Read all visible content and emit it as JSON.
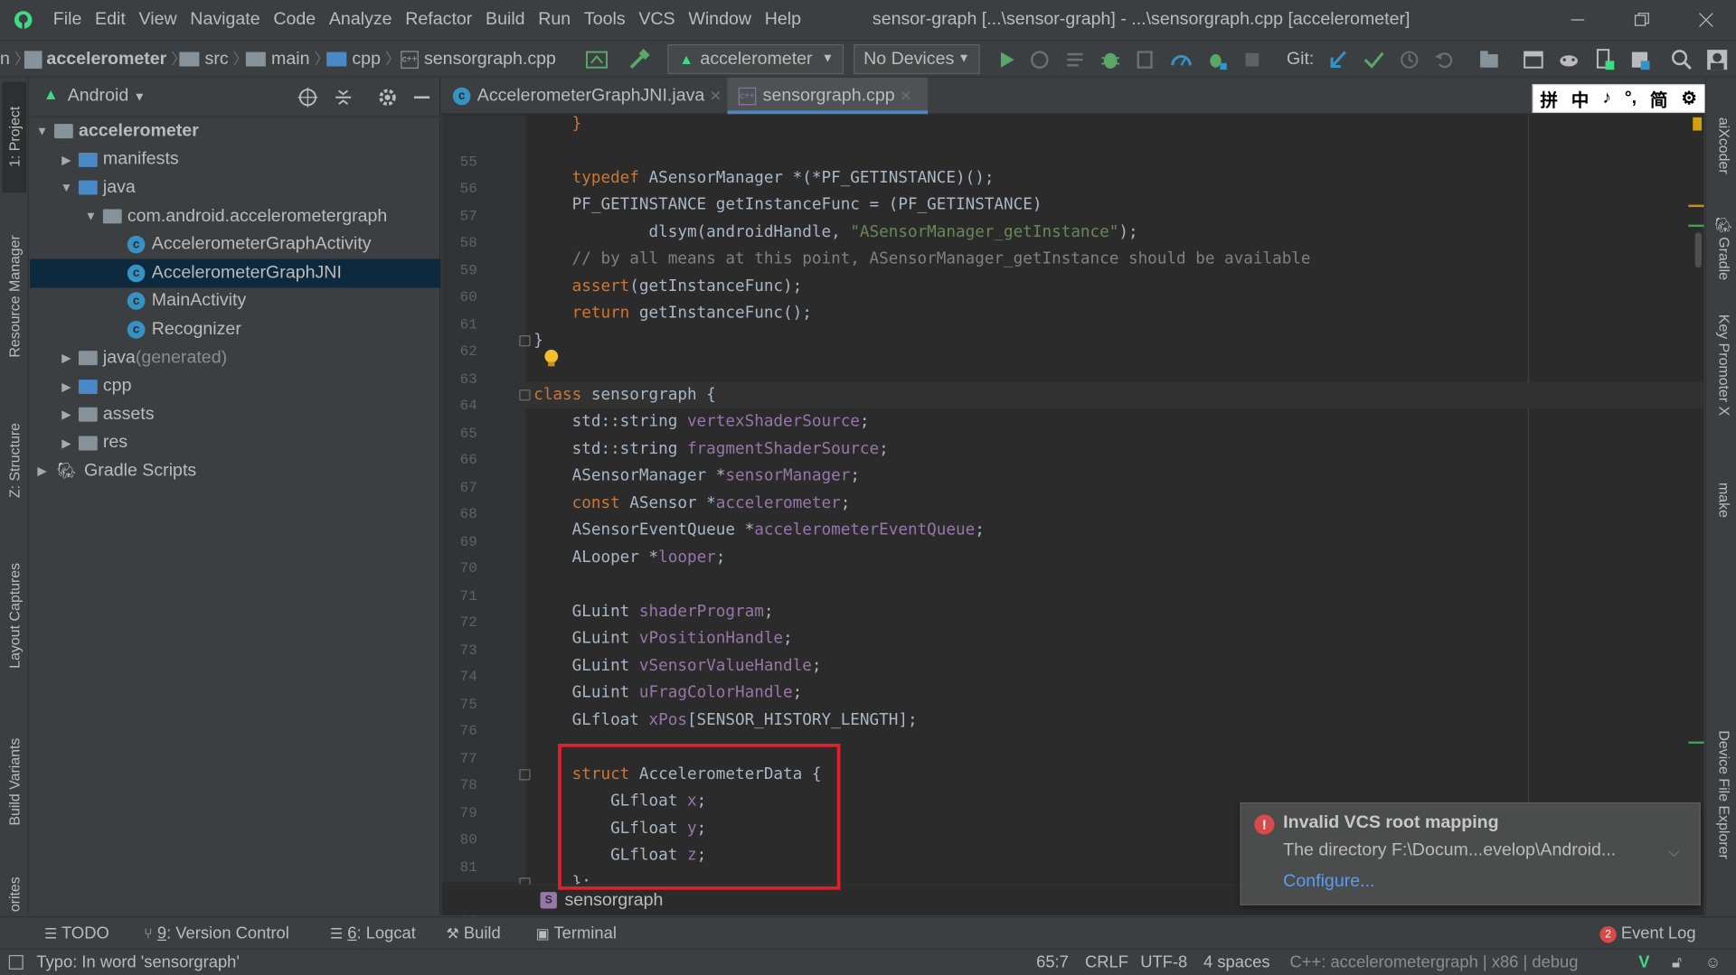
{
  "menu": [
    "File",
    "Edit",
    "View",
    "Navigate",
    "Code",
    "Analyze",
    "Refactor",
    "Build",
    "Run",
    "Tools",
    "VCS",
    "Window",
    "Help"
  ],
  "window_title": "sensor-graph [...\\sensor-graph] - ...\\sensorgraph.cpp [accelerometer]",
  "breadcrumbs": [
    "n",
    "accelerometer",
    "src",
    "main",
    "cpp",
    "sensorgraph.cpp"
  ],
  "run_config": "accelerometer",
  "device": "No Devices",
  "git_label": "Git:",
  "left_strip_tabs": [
    "1: Project",
    "Resource Manager",
    "Z: Structure",
    "Layout Captures",
    "Build Variants",
    "orites"
  ],
  "project_view": "Android",
  "tree": [
    {
      "label": "accelerometer",
      "indent": 0,
      "arrow": "▼",
      "icon": "module",
      "bold": true
    },
    {
      "label": "manifests",
      "indent": 1,
      "arrow": "▶",
      "icon": "folder-blue"
    },
    {
      "label": "java",
      "indent": 1,
      "arrow": "▼",
      "icon": "folder-blue"
    },
    {
      "label": "com.android.accelerometergraph",
      "indent": 2,
      "arrow": "▼",
      "icon": "package"
    },
    {
      "label": "AccelerometerGraphActivity",
      "indent": 3,
      "arrow": "",
      "icon": "class"
    },
    {
      "label": "AccelerometerGraphJNI",
      "indent": 3,
      "arrow": "",
      "icon": "class",
      "selected": true
    },
    {
      "label": "MainActivity",
      "indent": 3,
      "arrow": "",
      "icon": "class"
    },
    {
      "label": "Recognizer",
      "indent": 3,
      "arrow": "",
      "icon": "class"
    },
    {
      "label": "java",
      "suffix": " (generated)",
      "indent": 1,
      "arrow": "▶",
      "icon": "folder-gen"
    },
    {
      "label": "cpp",
      "indent": 1,
      "arrow": "▶",
      "icon": "folder-blue"
    },
    {
      "label": "assets",
      "indent": 1,
      "arrow": "▶",
      "icon": "folder-res"
    },
    {
      "label": "res",
      "indent": 1,
      "arrow": "▶",
      "icon": "folder-res"
    },
    {
      "label": "Gradle Scripts",
      "indent": 0,
      "arrow": "▶",
      "icon": "gradle"
    }
  ],
  "tabs": [
    {
      "label": "AccelerometerGraphJNI.java",
      "active": false
    },
    {
      "label": "sensorgraph.cpp",
      "active": true
    }
  ],
  "code_lines": [
    {
      "n": "55",
      "html": "    <span class=\"kw\">}</span>"
    },
    {
      "n": "56",
      "html": ""
    },
    {
      "n": "57",
      "html": "    <span class=\"kw\">typedef</span> ASensorManager *(*PF_GETINSTANCE)();"
    },
    {
      "n": "58",
      "html": "    PF_GETINSTANCE getInstanceFunc = (PF_GETINSTANCE)"
    },
    {
      "n": "59",
      "html": "            dlsym(androidHandle, <span class=\"str\">\"ASensorManager_getInstance\"</span>);"
    },
    {
      "n": "60",
      "html": "    <span class=\"cmt\">// by all means at this point, ASensorManager_getInstance should be available</span>"
    },
    {
      "n": "61",
      "html": "    <span class=\"kw\">assert</span>(getInstanceFunc);"
    },
    {
      "n": "62",
      "html": "    <span class=\"kw\">return</span> getInstanceFunc();"
    },
    {
      "n": "63",
      "html": "}"
    },
    {
      "n": "64",
      "html": ""
    },
    {
      "n": "65",
      "html": "<span class=\"kw\">class</span> sensorgraph {"
    },
    {
      "n": "66",
      "html": "    std::string <span class=\"fld\">vertexShaderSource</span>;"
    },
    {
      "n": "67",
      "html": "    std::string <span class=\"fld\">fragmentShaderSource</span>;"
    },
    {
      "n": "68",
      "html": "    ASensorManager *<span class=\"fld\">sensorManager</span>;"
    },
    {
      "n": "69",
      "html": "    <span class=\"kw\">const</span> ASensor *<span class=\"fld\">accelerometer</span>;"
    },
    {
      "n": "70",
      "html": "    ASensorEventQueue *<span class=\"fld\">accelerometerEventQueue</span>;"
    },
    {
      "n": "71",
      "html": "    ALooper *<span class=\"fld\">looper</span>;"
    },
    {
      "n": "72",
      "html": ""
    },
    {
      "n": "73",
      "html": "    GLuint <span class=\"fld\">shaderProgram</span>;"
    },
    {
      "n": "74",
      "html": "    GLuint <span class=\"fld\">vPositionHandle</span>;"
    },
    {
      "n": "75",
      "html": "    GLuint <span class=\"fld\">vSensorValueHandle</span>;"
    },
    {
      "n": "76",
      "html": "    GLuint <span class=\"fld\">uFragColorHandle</span>;"
    },
    {
      "n": "77",
      "html": "    GLfloat <span class=\"fld\">xPos</span>[SENSOR_HISTORY_LENGTH];"
    },
    {
      "n": "78",
      "html": ""
    },
    {
      "n": "79",
      "html": "    <span class=\"kw\">struct</span> AccelerometerData {"
    },
    {
      "n": "80",
      "html": "        GLfloat <span class=\"fld\">x</span>;"
    },
    {
      "n": "81",
      "html": "        GLfloat <span class=\"fld\">y</span>;"
    },
    {
      "n": "82",
      "html": "        GLfloat <span class=\"fld\">z</span>;"
    },
    {
      "n": "83",
      "html": "    };"
    }
  ],
  "editor_breadcrumb": "sensorgraph",
  "right_strip_tabs": [
    "aiXcoder",
    "Gradle",
    "Key Promoter X",
    "make",
    "Device File Explorer"
  ],
  "ime_glyphs": [
    "拼",
    "中",
    "♪",
    "°,",
    "简",
    "⚙",
    "⋮"
  ],
  "bottom_tabs": [
    {
      "prefix": "",
      "label": "TODO"
    },
    {
      "prefix": "9",
      "label": ": Version Control"
    },
    {
      "prefix": "6",
      "label": ": Logcat"
    },
    {
      "prefix": "",
      "label": "Build"
    },
    {
      "prefix": "",
      "label": "Terminal"
    }
  ],
  "event_log": {
    "count": "2",
    "label": "Event Log"
  },
  "status": {
    "message": "Typo: In word 'sensorgraph'",
    "position": "65:7",
    "line_sep": "CRLF",
    "encoding": "UTF-8",
    "indent": "4 spaces",
    "context": "C++: accelerometergraph | x86 | debug"
  },
  "notification": {
    "title": "Invalid VCS root mapping",
    "body": "The directory F:\\Docum...evelop\\Android...",
    "link": "Configure..."
  },
  "colors": {
    "accent": "#4a88c7",
    "highlight": "#e0202a",
    "error": "#d84a4a",
    "link": "#589df6"
  }
}
